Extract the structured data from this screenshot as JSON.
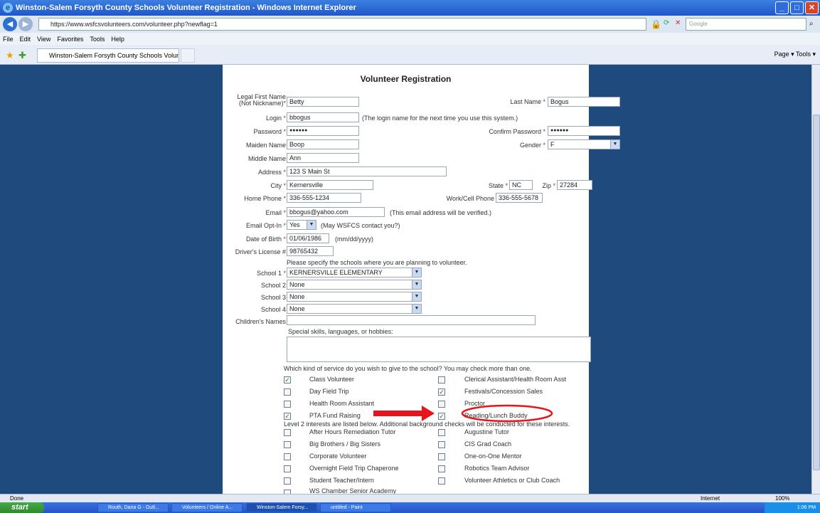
{
  "window": {
    "title": "Winston-Salem Forsyth County Schools Volunteer Registration - Windows Internet Explorer"
  },
  "browser": {
    "url": "https://www.wsfcsvolunteers.com/volunteer.php?newflag=1",
    "search_placeholder": "Google",
    "menu": [
      "File",
      "Edit",
      "View",
      "Favorites",
      "Tools",
      "Help"
    ],
    "tab_title": "Winston-Salem Forsyth County Schools Volunteer Reg...",
    "cmd": "Page ▾  Tools ▾"
  },
  "form": {
    "title": "Volunteer Registration",
    "first_name_label": "Legal First Name",
    "first_name_sub": "(Not Nickname)",
    "first_name": "Betty",
    "last_name_label": "Last Name",
    "last_name": "Bogus",
    "login_label": "Login",
    "login": "bbogus",
    "login_note": "(The login name for the next time you use this system.)",
    "password_label": "Password",
    "password": "●●●●●●",
    "confirm_label": "Confirm Password",
    "confirm": "●●●●●●",
    "maiden_label": "Maiden Name",
    "maiden": "Boop",
    "gender_label": "Gender",
    "gender": "F",
    "middle_label": "Middle Name",
    "middle": "Ann",
    "address_label": "Address",
    "address": "123 S Main St",
    "city_label": "City",
    "city": "Kernersville",
    "state_label": "State",
    "state": "NC",
    "zip_label": "Zip",
    "zip": "27284",
    "home_phone_label": "Home Phone",
    "home_phone": "336-555-1234",
    "work_phone_label": "Work/Cell Phone",
    "work_phone": "336-555-5678",
    "email_label": "Email",
    "email": "bbogus@yahoo.com",
    "email_note": "(This email address will be verified.)",
    "optin_label": "Email Opt-In",
    "optin": "Yes",
    "optin_note": "(May WSFCS contact you?)",
    "dob_label": "Date of Birth",
    "dob": "01/06/1986",
    "dob_note": "(mm/dd/yyyy)",
    "license_label": "Driver's License #",
    "license": "98765432",
    "schools_intro": "Please specify the schools where you are planning to volunteer.",
    "school1_label": "School 1",
    "school1": "KERNERSVILLE ELEMENTARY",
    "school2_label": "School 2",
    "school2": "None",
    "school3_label": "School 3",
    "school3": "None",
    "school4_label": "School 4",
    "school4": "None",
    "children_label": "Children's Names",
    "skills_label": "Special skills, languages, or hobbies:",
    "service_intro": "Which kind of service do you wish to give to the school? You may check more than one.",
    "level2_intro": "Level 2 interests are listed below. Additional background checks will be conducted for these interests.",
    "services_left": [
      {
        "label": "Class Volunteer",
        "checked": true
      },
      {
        "label": "Day Field Trip",
        "checked": false
      },
      {
        "label": "Health Room Assistant",
        "checked": false
      },
      {
        "label": "PTA Fund Raising",
        "checked": true
      }
    ],
    "services_right": [
      {
        "label": "Clerical Assistant/Health Room Asst",
        "checked": false
      },
      {
        "label": "Festivals/Concession Sales",
        "checked": true
      },
      {
        "label": "Proctor",
        "checked": false
      },
      {
        "label": "Reading/Lunch Buddy",
        "checked": true
      }
    ],
    "level2_left": [
      "After Hours Remediation Tutor",
      "Big Brothers / Big Sisters",
      "Corporate Volunteer",
      "Overnight Field Trip Chaperone",
      "Student Teacher/Intern",
      "WS Chamber Senior Academy"
    ],
    "level2_right": [
      "Augustine Tutor",
      "CIS Grad Coach",
      "One-on-One Mentor",
      "Robotics Team Advisor",
      "Volunteer Athletics or Club Coach"
    ]
  },
  "status": {
    "left": "Done",
    "zone": "Internet",
    "zoom": "100%"
  },
  "taskbar": {
    "start": "start",
    "tasks": [
      "Routh, Dana G - Outl...",
      "Volunteers / Online A...",
      "Winston-Salem Forsy...",
      "untitled - Paint"
    ],
    "clock": "1:06 PM"
  },
  "colors": {
    "annotation": "#e8141c",
    "page_bg": "#1e4a7d"
  }
}
